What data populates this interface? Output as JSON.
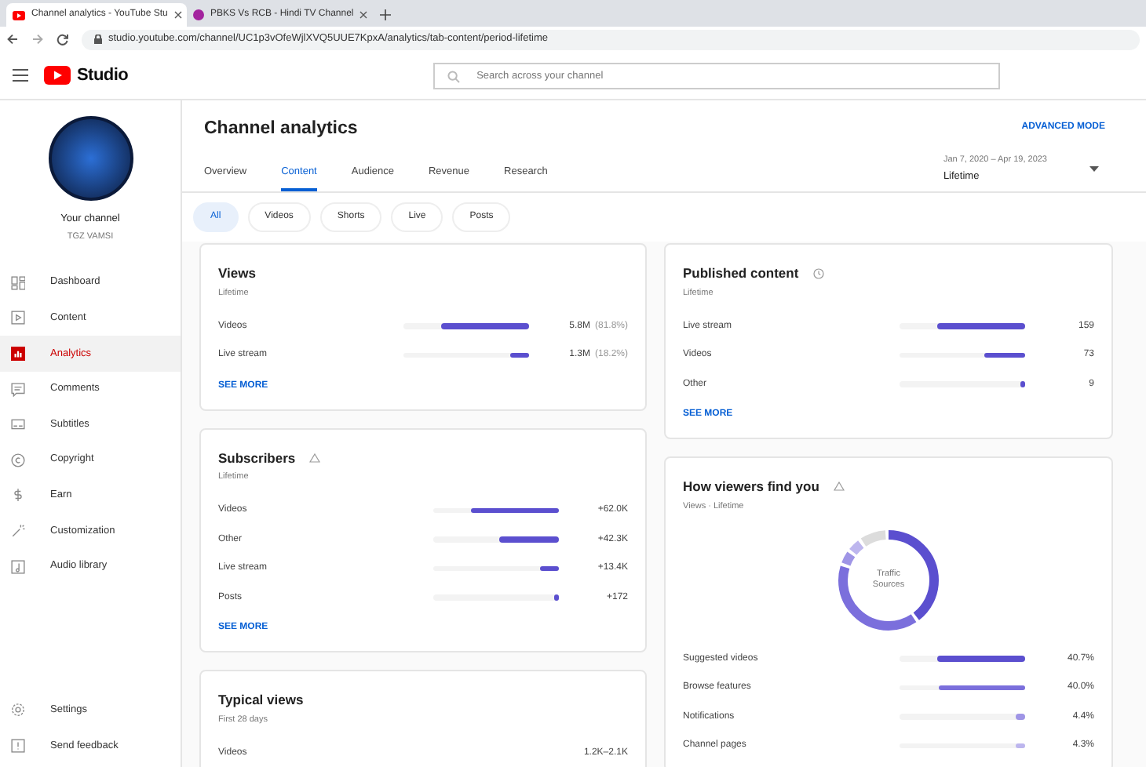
{
  "browser": {
    "tabs": [
      {
        "title": "Channel analytics - YouTube Stu",
        "selected": true
      },
      {
        "title": "PBKS Vs RCB - Hindi TV Channel",
        "selected": false
      }
    ],
    "url": "studio.youtube.com/channel/UC1p3vOfeWjlXVQ5UUE7KpxA/analytics/tab-content/period-lifetime"
  },
  "header": {
    "logo": "Studio",
    "search": {
      "placeholder": "Search across your channel"
    }
  },
  "sidebar": {
    "channel_label": "Your channel",
    "channel_name": "TGZ VAMSI",
    "items": [
      {
        "label": "Dashboard",
        "selected": false
      },
      {
        "label": "Content",
        "selected": false
      },
      {
        "label": "Analytics",
        "selected": true
      },
      {
        "label": "Comments",
        "selected": false
      },
      {
        "label": "Subtitles",
        "selected": false
      },
      {
        "label": "Copyright",
        "selected": false
      },
      {
        "label": "Earn",
        "selected": false
      },
      {
        "label": "Customization",
        "selected": false
      },
      {
        "label": "Audio library",
        "selected": false
      }
    ],
    "footer_items": [
      {
        "label": "Settings"
      },
      {
        "label": "Send feedback"
      }
    ]
  },
  "page": {
    "title": "Channel analytics",
    "advanced_mode": "ADVANCED MODE",
    "tabs": [
      {
        "label": "Overview",
        "selected": false
      },
      {
        "label": "Content",
        "selected": true
      },
      {
        "label": "Audience",
        "selected": false
      },
      {
        "label": "Revenue",
        "selected": false
      },
      {
        "label": "Research",
        "selected": false
      }
    ],
    "date_range": {
      "range": "Jan 7, 2020 – Apr 19, 2023",
      "period": "Lifetime"
    },
    "chips": [
      {
        "label": "All",
        "selected": true
      },
      {
        "label": "Videos",
        "selected": false
      },
      {
        "label": "Shorts",
        "selected": false
      },
      {
        "label": "Live",
        "selected": false
      },
      {
        "label": "Posts",
        "selected": false
      }
    ]
  },
  "left_cards": [
    {
      "title": "Views",
      "subtitle": "Lifetime",
      "rows": [
        {
          "label": "Videos",
          "level": 0.7,
          "value": "5.8M",
          "share": "(81.8%)"
        },
        {
          "label": "Live stream",
          "level": 0.15,
          "value": "1.3M",
          "share": "(18.2%)"
        }
      ],
      "link": "SEE MORE"
    },
    {
      "title": "Subscribers",
      "subtitle": "Lifetime",
      "rows": [
        {
          "label": "Videos",
          "level": 0.7,
          "value": "+62.0K"
        },
        {
          "label": "Other",
          "level": 0.48,
          "value": "+42.3K"
        },
        {
          "label": "Live stream",
          "level": 0.15,
          "value": "+13.4K"
        },
        {
          "label": "Posts",
          "level": 0.04,
          "value": "+172"
        }
      ],
      "link": "SEE MORE"
    },
    {
      "title": "Typical views",
      "subtitle": "First 28 days",
      "rows": [
        {
          "label": "Videos",
          "value": "1.2K–2.1K"
        }
      ]
    }
  ],
  "right_cards": [
    {
      "title": "Published content",
      "subtitle": "Lifetime",
      "rows": [
        {
          "label": "Live stream",
          "level": 0.7,
          "value": "159"
        },
        {
          "label": "Videos",
          "level": 0.33,
          "value": "73"
        },
        {
          "label": "Other",
          "level": 0.04,
          "value": "9"
        }
      ],
      "link": "SEE MORE"
    },
    {
      "title": "How viewers find you",
      "subtitle": "Views · Lifetime",
      "donut_label": "Traffic Sources",
      "rows": [
        {
          "label": "Suggested videos",
          "level": 0.7,
          "value": "40.7%",
          "color": "#5b4fcf"
        },
        {
          "label": "Browse features",
          "level": 0.69,
          "value": "40.0%",
          "color": "#7b6fdc"
        },
        {
          "label": "Notifications",
          "level": 0.08,
          "value": "4.4%",
          "color": "#9f95e6"
        },
        {
          "label": "Channel pages",
          "level": 0.07,
          "value": "4.3%",
          "color": "#bdb6ee"
        }
      ]
    }
  ]
}
